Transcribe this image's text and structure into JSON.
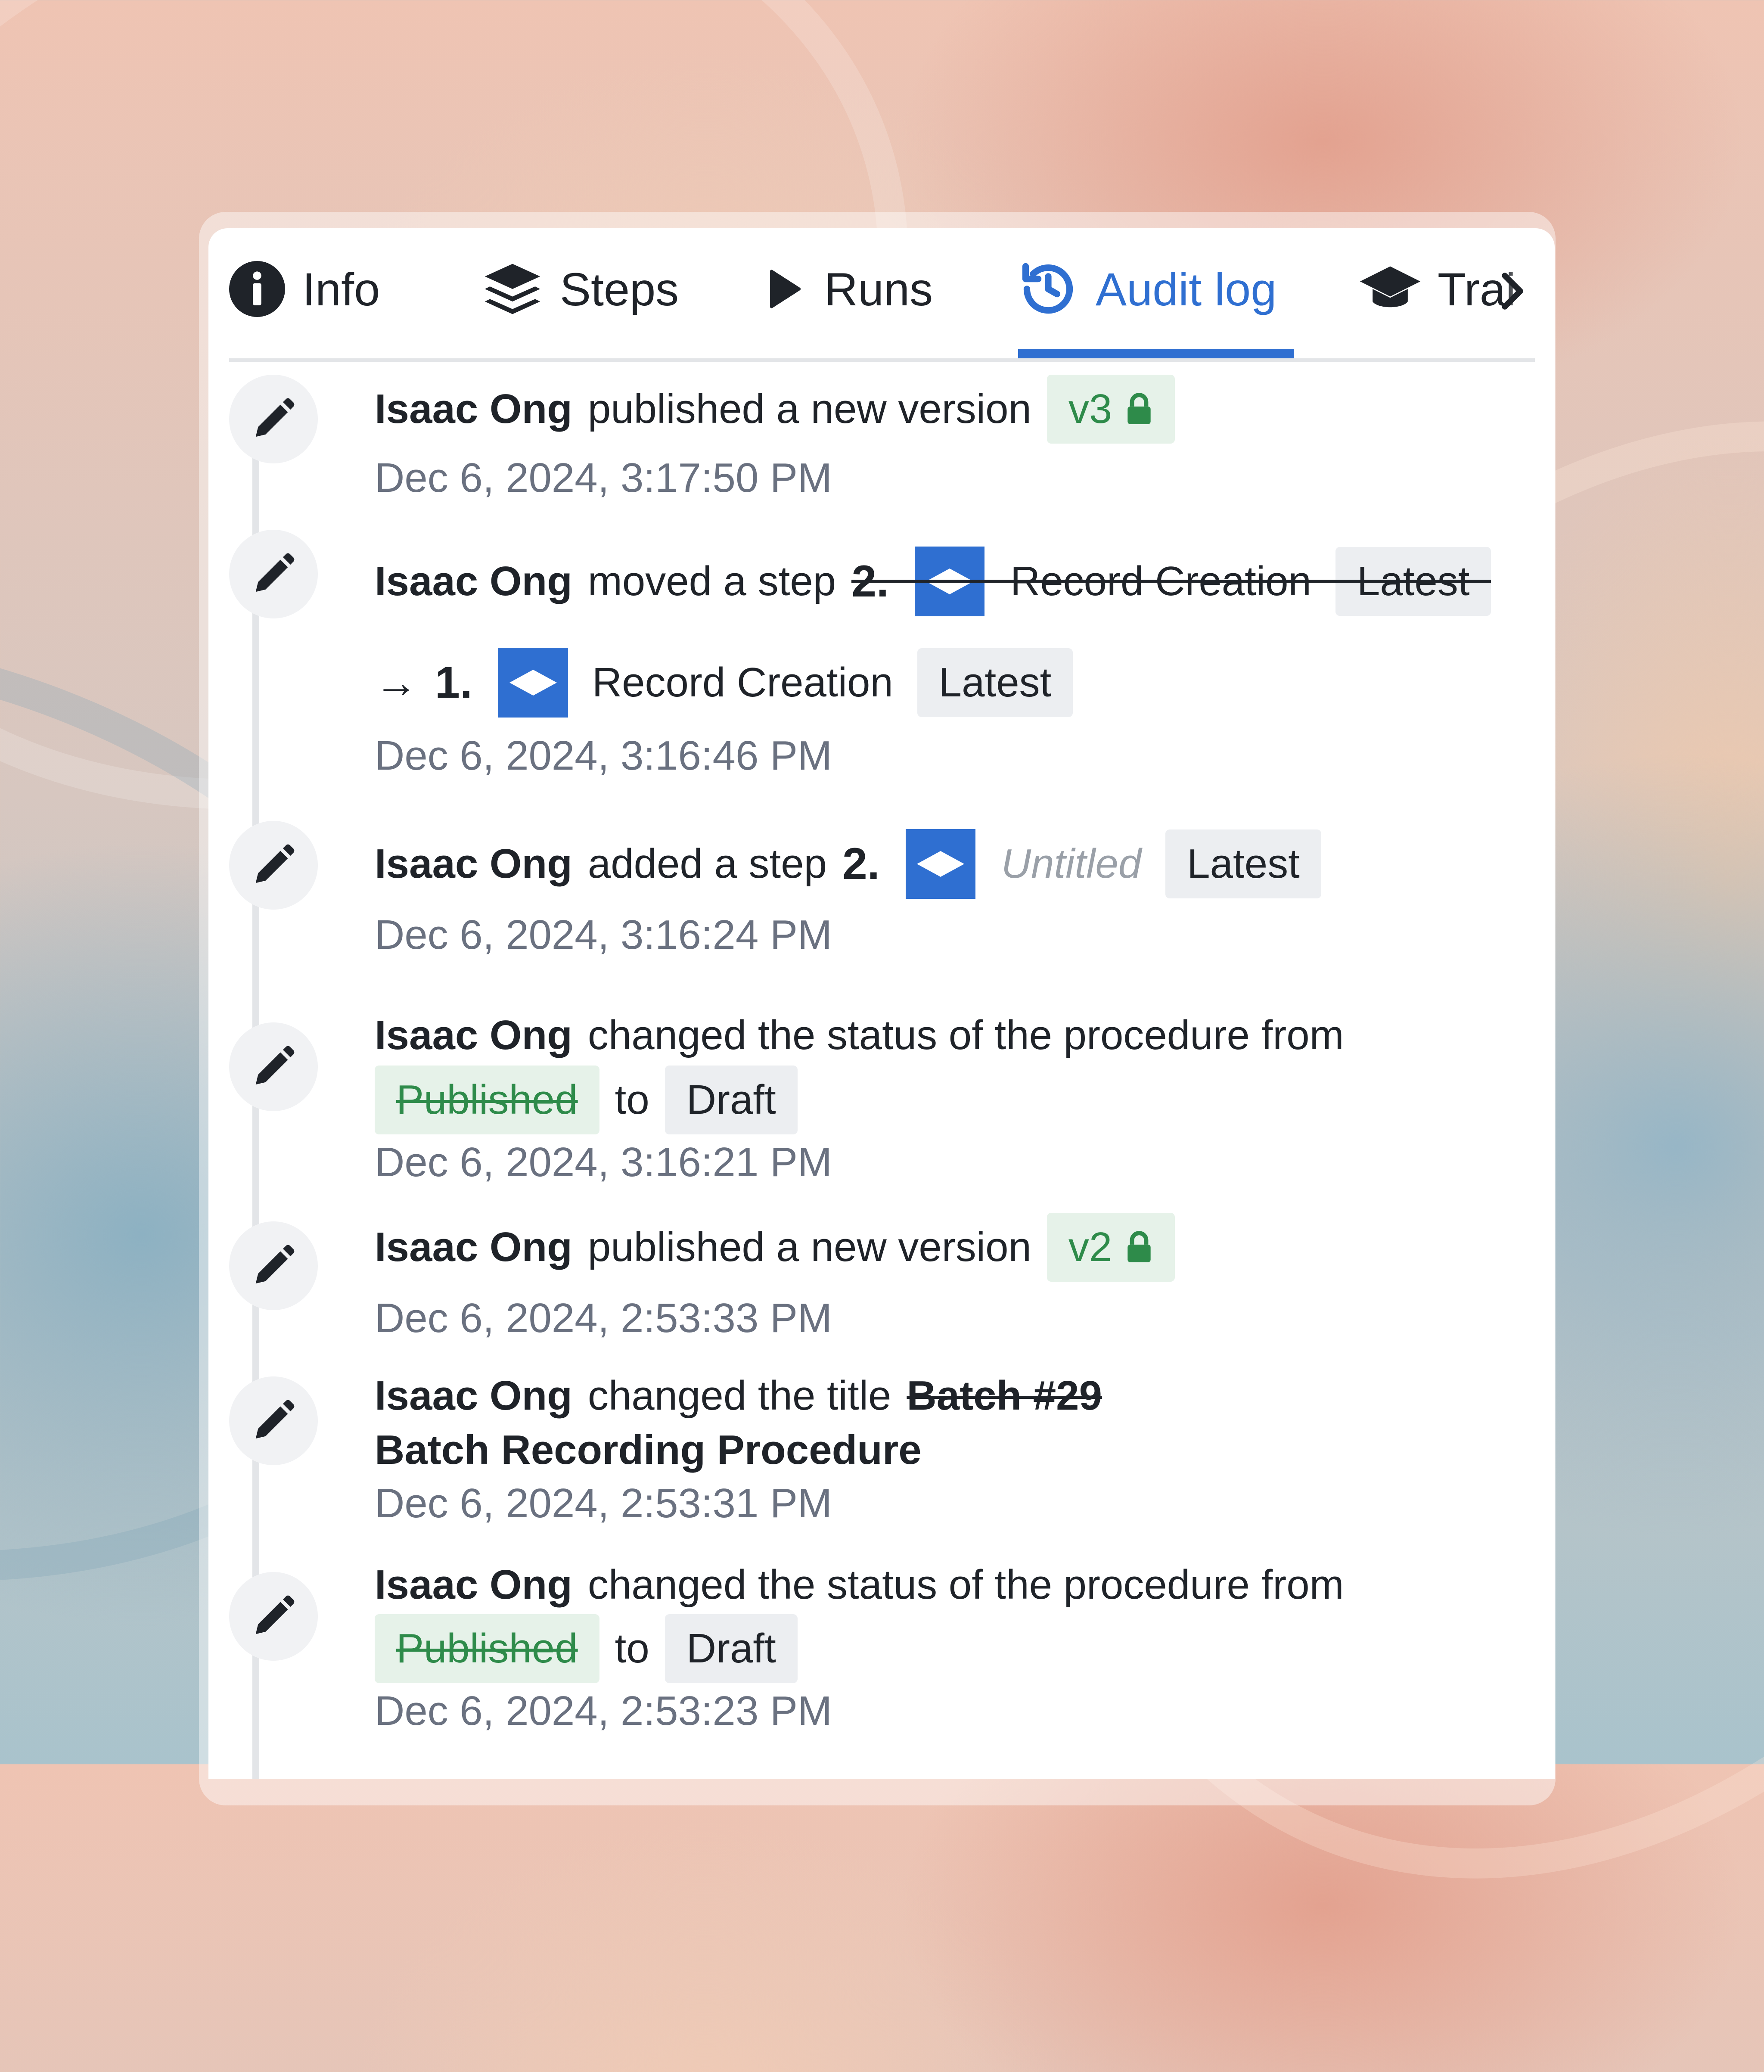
{
  "colors": {
    "accent": "#2f6fd1",
    "text": "#1f2329",
    "muted": "#6a7180",
    "published_green": "#2e8b4a",
    "badge_gray": "#eceef1"
  },
  "tabs": [
    {
      "label": "Info",
      "icon": "info-circle-icon"
    },
    {
      "label": "Steps",
      "icon": "layers-icon"
    },
    {
      "label": "Runs",
      "icon": "play-icon"
    },
    {
      "label": "Audit log",
      "icon": "history-icon",
      "active": true
    },
    {
      "label": "Trai",
      "icon": "graduation-cap-icon"
    }
  ],
  "tab_scroll_icon": "chevron-right-icon",
  "entries": [
    {
      "icon": "pencil-icon",
      "actor": "Isaac Ong",
      "action": "published a new version",
      "version": "v3",
      "version_icon": "lock-icon",
      "time": "Dec 6, 2024, 3:17:50 PM"
    },
    {
      "icon": "pencil-icon",
      "actor": "Isaac Ong",
      "action": "moved a step",
      "old_step": {
        "number": "2.",
        "title": "Record Creation",
        "tag": "Latest"
      },
      "arrow": "→",
      "new_step": {
        "number": "1.",
        "title": "Record Creation",
        "tag": "Latest"
      },
      "step_icon": "step-diamond-icon",
      "time": "Dec 6, 2024, 3:16:46 PM"
    },
    {
      "icon": "pencil-icon",
      "actor": "Isaac Ong",
      "action": "added a step",
      "step": {
        "number": "2.",
        "title": "Untitled",
        "tag": "Latest"
      },
      "time": "Dec 6, 2024, 3:16:24 PM"
    },
    {
      "icon": "pencil-icon",
      "actor": "Isaac Ong",
      "action": "changed the status of the procedure from",
      "from_status": "Published",
      "to_word": "to",
      "to_status": "Draft",
      "time": "Dec 6, 2024, 3:16:21 PM"
    },
    {
      "icon": "pencil-icon",
      "actor": "Isaac Ong",
      "action": "published a new version",
      "version": "v2",
      "version_icon": "lock-icon",
      "time": "Dec 6, 2024, 2:53:33 PM"
    },
    {
      "icon": "pencil-icon",
      "actor": "Isaac Ong",
      "action": "changed the title",
      "old_title": "Batch #29",
      "new_title": "Batch Recording Procedure",
      "time": "Dec 6, 2024, 2:53:31 PM"
    },
    {
      "icon": "pencil-icon",
      "actor": "Isaac Ong",
      "action": "changed the status of the procedure from",
      "from_status": "Published",
      "to_word": "to",
      "to_status": "Draft",
      "time": "Dec 6, 2024, 2:53:23 PM"
    }
  ]
}
